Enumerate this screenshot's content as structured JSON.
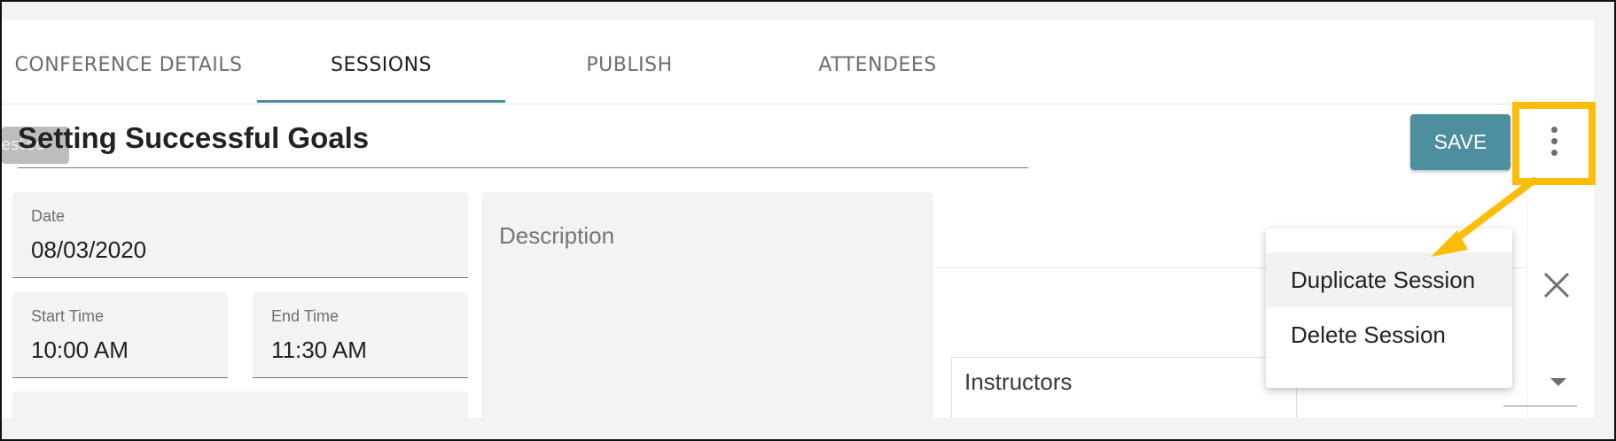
{
  "tabs": [
    {
      "label": "CONFERENCE DETAILS",
      "active": false
    },
    {
      "label": "SESSIONS",
      "active": true
    },
    {
      "label": "PUBLISH",
      "active": false
    },
    {
      "label": "ATTENDEES",
      "active": false
    }
  ],
  "session": {
    "chip_text": "tested",
    "title": "Setting Successful Goals"
  },
  "toolbar": {
    "save_label": "SAVE",
    "more_icon": "more-vert-icon"
  },
  "form": {
    "date_label": "Date",
    "date_value": "08/03/2020",
    "start_label": "Start Time",
    "start_value": "10:00 AM",
    "end_label": "End Time",
    "end_value": "11:30 AM",
    "description_label": "Description"
  },
  "side_panel": {
    "instructors_label": "Instructors",
    "close_icon": "close-icon"
  },
  "menu": {
    "items": [
      {
        "label": "Duplicate Session",
        "highlighted": true
      },
      {
        "label": "Delete Session",
        "highlighted": false
      }
    ]
  },
  "colors": {
    "accent": "#4d8f9e",
    "highlight": "#ffbd07",
    "field_bg": "#f3f3f3"
  }
}
